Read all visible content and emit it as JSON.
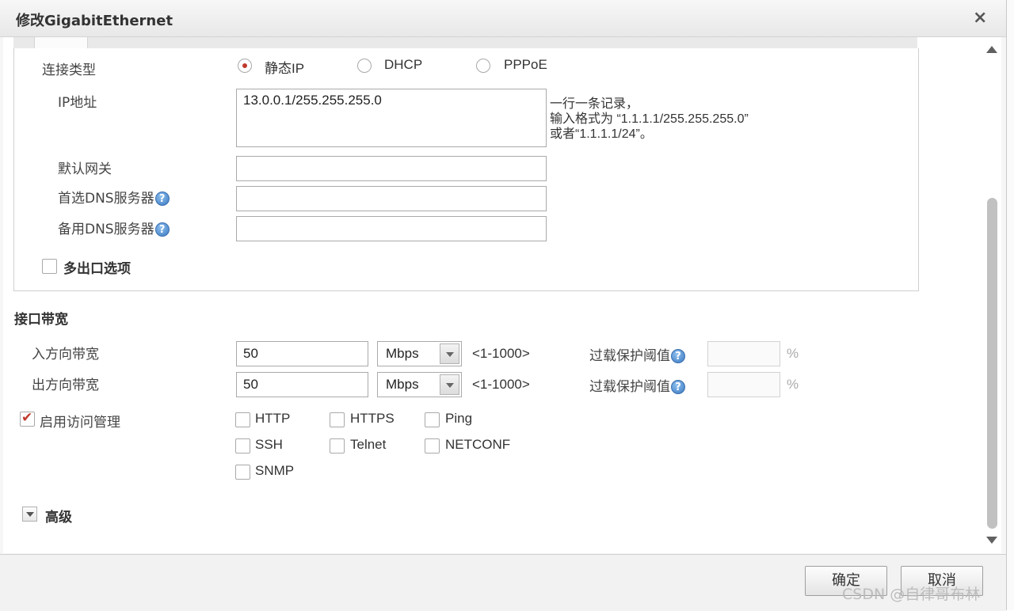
{
  "dialog": {
    "title": "修改GigabitEthernet",
    "close_glyph": "×"
  },
  "connection": {
    "label": "连接类型",
    "options": [
      {
        "label": "静态IP",
        "selected": true
      },
      {
        "label": "DHCP",
        "selected": false
      },
      {
        "label": "PPPoE",
        "selected": false
      }
    ]
  },
  "ip": {
    "label": "IP地址",
    "value": "13.0.0.1/255.255.255.0",
    "hint_lines": [
      "一行一条记录，",
      "输入格式为 “1.1.1.1/255.255.255.0”",
      "或者“1.1.1.1/24”。"
    ]
  },
  "gateway": {
    "label": "默认网关",
    "value": ""
  },
  "dns1": {
    "label": "首选DNS服务器",
    "value": ""
  },
  "dns2": {
    "label": "备用DNS服务器",
    "value": ""
  },
  "help_glyph": "?",
  "multi_exit": {
    "label": "多出口选项",
    "checked": false
  },
  "bandwidth": {
    "section_title": "接口带宽",
    "rows": [
      {
        "label": "入方向带宽",
        "value": "50",
        "unit": "Mbps",
        "range": "<1-1000>",
        "overload_label": "过载保护阈值",
        "overload_value": "",
        "pct": "%"
      },
      {
        "label": "出方向带宽",
        "value": "50",
        "unit": "Mbps",
        "range": "<1-1000>",
        "overload_label": "过载保护阈值",
        "overload_value": "",
        "pct": "%"
      }
    ]
  },
  "access": {
    "label": "启用访问管理",
    "checked": true,
    "protocols": [
      {
        "label": "HTTP",
        "checked": false
      },
      {
        "label": "HTTPS",
        "checked": false
      },
      {
        "label": "Ping",
        "checked": false
      },
      {
        "label": "SSH",
        "checked": false
      },
      {
        "label": "Telnet",
        "checked": false
      },
      {
        "label": "NETCONF",
        "checked": false
      },
      {
        "label": "SNMP",
        "checked": false
      }
    ]
  },
  "advanced": {
    "label": "高级"
  },
  "buttons": {
    "ok": "确定",
    "cancel": "取消"
  },
  "watermark": "CSDN @自律哥布林",
  "colors": {
    "radio_selected": "#c0392b",
    "help_icon": "#3a78c2"
  }
}
